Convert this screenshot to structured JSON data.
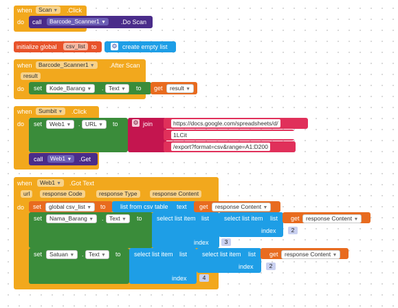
{
  "blocks": {
    "scan_click": {
      "when": "when",
      "component": "Scan",
      "event": ".Click",
      "do": "do",
      "call": "call",
      "target": "Barcode_Scanner1",
      "method": ".Do Scan"
    },
    "init_global": {
      "label": "initialize global",
      "var": "csv_list",
      "to": "to",
      "create": "create empty list"
    },
    "after_scan": {
      "when": "when",
      "component": "Barcode_Scanner1",
      "event": ".After Scan",
      "param": "result",
      "do": "do",
      "set": "set",
      "target": "Kode_Barang",
      "prop": "Text",
      "to": "to",
      "get": "get",
      "getvar": "result"
    },
    "submit_click": {
      "when": "when",
      "component": "Sumbit",
      "event": ".Click",
      "do": "do",
      "set": "set",
      "target": "Web1",
      "prop": "URL",
      "to": "to",
      "join": "join",
      "url1": "https://docs.google.com/spreadsheets/d/",
      "url2": "1LCit",
      "url3": "/export?format=csv&range=A1:D200",
      "call": "call",
      "call_target": "Web1",
      "call_method": ".Get"
    },
    "got_text": {
      "when": "when",
      "component": "Web1",
      "event": ".Got Text",
      "params": [
        "url",
        "response Code",
        "response Type",
        "response Content"
      ],
      "do": "do",
      "set_global": "set",
      "global_var": "global csv_list",
      "to": "to",
      "from_csv": "list from csv table",
      "text": "text",
      "get": "get",
      "response": "response Content",
      "set1": "set",
      "target1": "Nama_Barang",
      "prop1": "Text",
      "to1": "to",
      "select": "select list item",
      "list": "list",
      "index": "index",
      "inner_index1": "2",
      "outer_index1": "3",
      "set2": "set",
      "target2": "Satuan",
      "prop2": "Text",
      "to2": "to",
      "inner_index2": "2",
      "outer_index2": "4"
    }
  }
}
